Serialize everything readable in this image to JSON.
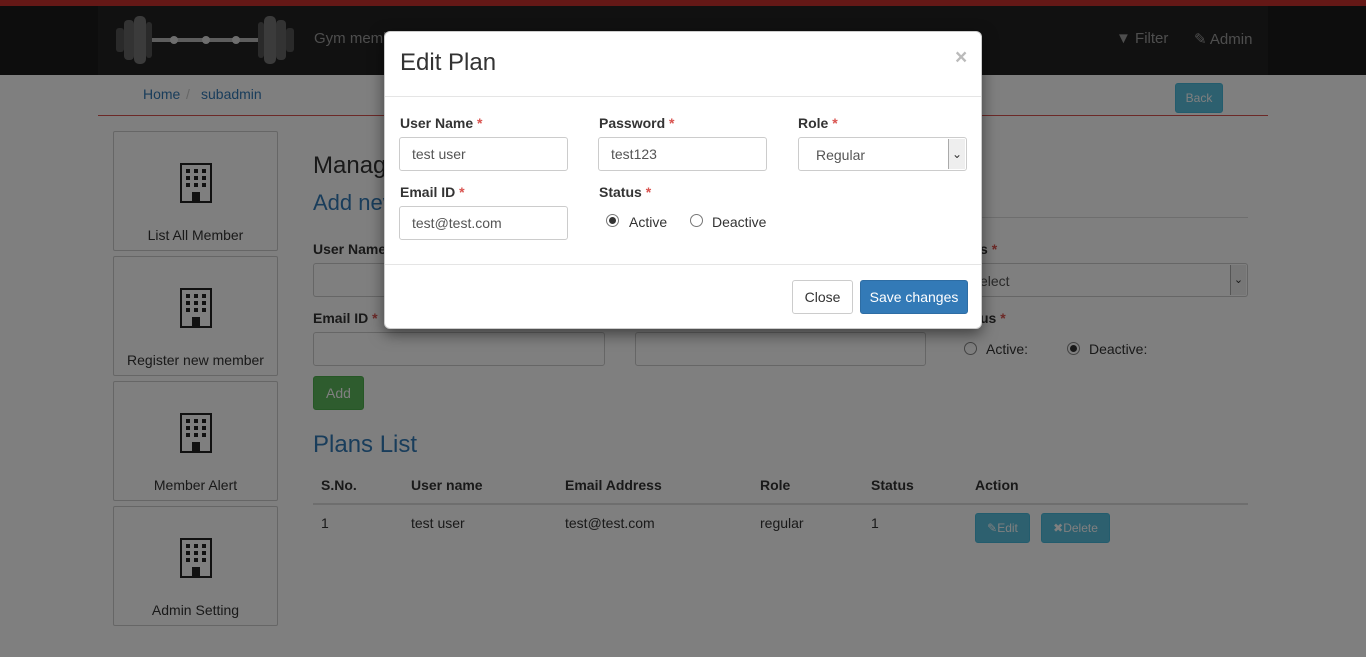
{
  "header": {
    "brand": "Gym memb",
    "filter_label": "Filter",
    "admin_label": "Admin"
  },
  "breadcrumb": {
    "home": "Home",
    "separator": "/",
    "current": "subadmin",
    "back_label": "Back"
  },
  "sidebar": {
    "items": [
      {
        "label": "List All Member"
      },
      {
        "label": "Register new member"
      },
      {
        "label": "Member Alert"
      },
      {
        "label": "Admin Setting"
      }
    ]
  },
  "main": {
    "manage_title": "Manag",
    "add_new_title": "Add nev",
    "form": {
      "user_name_label": "User Name",
      "email_label": "Email ID",
      "required_mark": "*",
      "role_label_partial": "s",
      "role_placeholder": "elect",
      "status_label_partial": "us",
      "status_options": [
        "Active:",
        "Deactive:"
      ],
      "status_selected": "Deactive:",
      "add_button": "Add"
    },
    "plans_title": "Plans List",
    "table": {
      "columns": [
        "S.No.",
        "User name",
        "Email Address",
        "Role",
        "Status",
        "Action"
      ],
      "rows": [
        {
          "sno": "1",
          "user_name": "test user",
          "email": "test@test.com",
          "role": "regular",
          "status": "1"
        }
      ],
      "edit_label": "Edit",
      "delete_label": "Delete"
    }
  },
  "modal": {
    "title": "Edit Plan",
    "close_symbol": "×",
    "required_mark": "*",
    "fields": {
      "user_name_label": "User Name",
      "user_name_value": "test user",
      "password_label": "Password",
      "password_value": "test123",
      "role_label": "Role",
      "role_value": "Regular",
      "email_label": "Email ID",
      "email_value": "test@test.com",
      "status_label": "Status",
      "status_options": [
        "Active",
        "Deactive"
      ],
      "status_selected": "Active"
    },
    "close_button": "Close",
    "save_button": "Save changes"
  },
  "colors": {
    "accent": "#337ab7",
    "danger": "#d9534f",
    "info": "#5bc0de",
    "success": "#5cb85c",
    "header_bg": "#222222"
  }
}
